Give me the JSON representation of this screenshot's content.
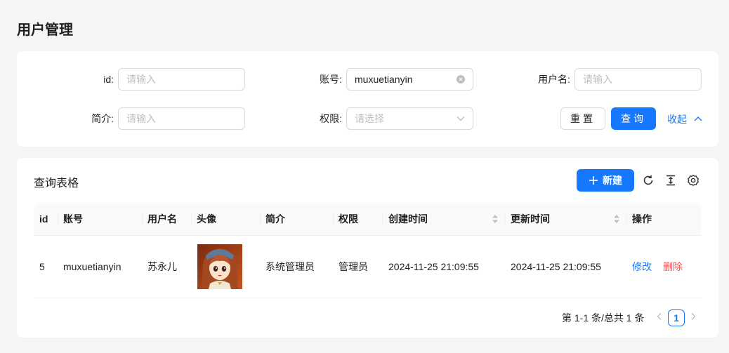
{
  "page": {
    "title": "用户管理"
  },
  "search": {
    "id": {
      "label": "id:",
      "value": "",
      "placeholder": "请输入"
    },
    "account": {
      "label": "账号:",
      "value": "muxuetianyin",
      "placeholder": "请输入"
    },
    "username": {
      "label": "用户名:",
      "value": "",
      "placeholder": "请输入"
    },
    "profile": {
      "label": "简介:",
      "value": "",
      "placeholder": "请输入"
    },
    "role": {
      "label": "权限:",
      "value": "",
      "placeholder": "请选择"
    },
    "reset_label": "重置",
    "query_label": "查询",
    "collapse_label": "收起"
  },
  "table": {
    "title": "查询表格",
    "new_label": "新建",
    "columns": [
      "id",
      "账号",
      "用户名",
      "头像",
      "简介",
      "权限",
      "创建时间",
      "更新时间",
      "操作"
    ],
    "rows": [
      {
        "id": "5",
        "account": "muxuetianyin",
        "username": "苏永儿",
        "profile": "系统管理员",
        "role": "管理员",
        "created": "2024-11-25 21:09:55",
        "updated": "2024-11-25 21:09:55",
        "edit_label": "修改",
        "delete_label": "删除"
      }
    ]
  },
  "pagination": {
    "total_text": "第 1-1 条/总共 1 条",
    "current_page": "1"
  },
  "colors": {
    "primary": "#1677ff",
    "danger": "#ff4d4f"
  },
  "icons": [
    "clear-icon",
    "chevron-down-icon",
    "chevron-up-icon",
    "plus-icon",
    "reload-icon",
    "density-icon",
    "settings-icon",
    "sort-icon",
    "chevron-left-icon",
    "chevron-right-icon"
  ]
}
